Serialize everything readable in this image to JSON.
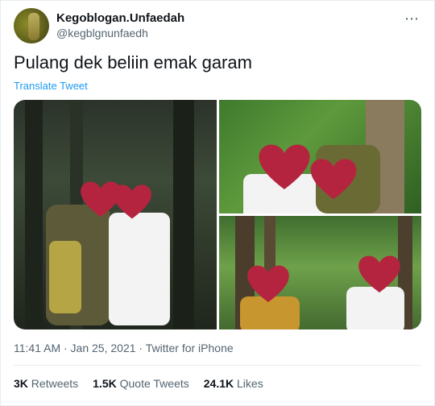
{
  "tweet": {
    "display_name": "Kegoblogan.Unfaedah",
    "handle": "@kegblgnunfaedh",
    "more_label": "⋯",
    "text": "Pulang dek beliin emak garam",
    "translate_label": "Translate Tweet",
    "meta": "11:41 AM · Jan 25, 2021 · Twitter for iPhone"
  },
  "stats": {
    "retweets_count": "3K",
    "retweets_label": "Retweets",
    "quotes_count": "1.5K",
    "quotes_label": "Quote Tweets",
    "likes_count": "24.1K",
    "likes_label": "Likes"
  },
  "colors": {
    "link": "#1d9bf0",
    "heart": "#b5243e",
    "secondary_text": "#536471"
  },
  "icons": [
    "more-icon",
    "heart-sticker-icon"
  ]
}
